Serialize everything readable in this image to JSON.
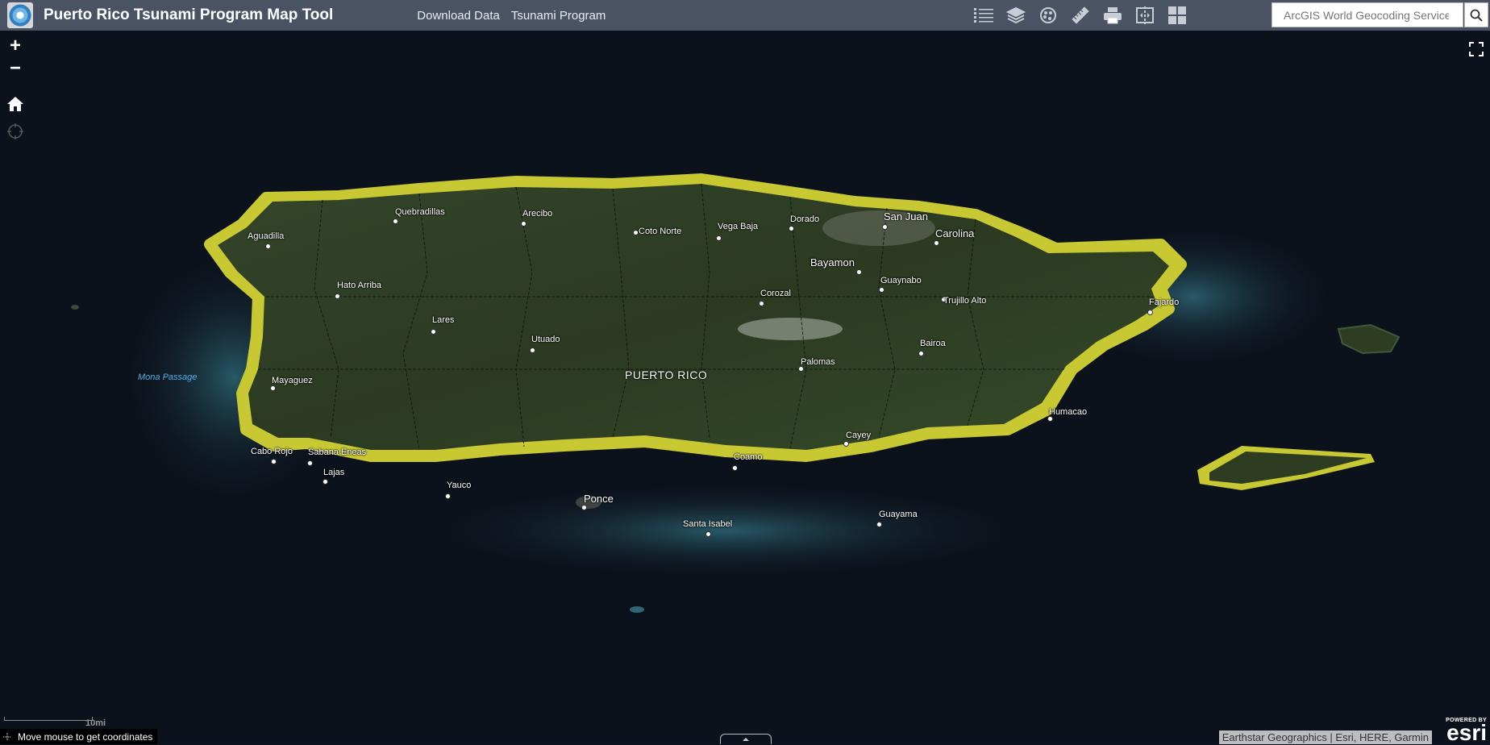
{
  "header": {
    "title": "Puerto Rico Tsunami Program Map Tool",
    "nav": [
      "Download Data",
      "Tsunami Program"
    ],
    "search_placeholder": "ArcGIS World Geocoding Service"
  },
  "tools": [
    "list-icon",
    "layers-icon",
    "basemap-gallery-icon",
    "measure-icon",
    "print-icon",
    "swipe-icon",
    "widgets-grid-icon"
  ],
  "map": {
    "zoom_in": "+",
    "zoom_out": "−",
    "water_label": "Mona Passage",
    "country_label": "PUERTO RICO",
    "places": [
      {
        "name": "Aguadilla"
      },
      {
        "name": "Quebradillas"
      },
      {
        "name": "Arecibo"
      },
      {
        "name": "Coto Norte"
      },
      {
        "name": "Vega Baja"
      },
      {
        "name": "Dorado"
      },
      {
        "name": "San Juan"
      },
      {
        "name": "Carolina"
      },
      {
        "name": "Bayamon"
      },
      {
        "name": "Guaynabo"
      },
      {
        "name": "Trujillo Alto"
      },
      {
        "name": "Fajardo"
      },
      {
        "name": "Hato Arriba"
      },
      {
        "name": "Lares"
      },
      {
        "name": "Utuado"
      },
      {
        "name": "Corozal"
      },
      {
        "name": "Bairoa"
      },
      {
        "name": "Palomas"
      },
      {
        "name": "Mayaguez"
      },
      {
        "name": "Humacao"
      },
      {
        "name": "Cayey"
      },
      {
        "name": "Cabo Rojo"
      },
      {
        "name": "Sabana Eneas"
      },
      {
        "name": "Lajas"
      },
      {
        "name": "Yauco"
      },
      {
        "name": "Ponce"
      },
      {
        "name": "Coamo"
      },
      {
        "name": "Santa Isabel"
      },
      {
        "name": "Guayama"
      }
    ]
  },
  "footer": {
    "coords_text": "Move mouse to get coordinates",
    "attribution": "Earthstar Geographics | Esri, HERE, Garmin",
    "esri_powered": "POWERED BY",
    "esri_word": "esri",
    "scale": "10mi"
  },
  "colors": {
    "header_bg": "#4a5363",
    "tsunami_zone": "#c8c832",
    "land": "#2e3d22",
    "ocean": "#0c121c"
  }
}
